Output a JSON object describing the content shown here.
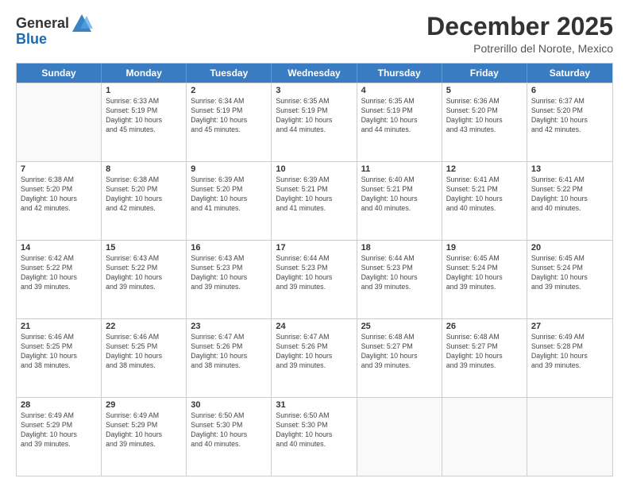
{
  "header": {
    "logo_general": "General",
    "logo_blue": "Blue",
    "month_title": "December 2025",
    "subtitle": "Potrerillo del Norote, Mexico"
  },
  "days_of_week": [
    "Sunday",
    "Monday",
    "Tuesday",
    "Wednesday",
    "Thursday",
    "Friday",
    "Saturday"
  ],
  "weeks": [
    [
      {
        "day": "",
        "empty": true
      },
      {
        "day": "1",
        "sunrise": "6:33 AM",
        "sunset": "5:19 PM",
        "daylight": "10 hours and 45 minutes."
      },
      {
        "day": "2",
        "sunrise": "6:34 AM",
        "sunset": "5:19 PM",
        "daylight": "10 hours and 45 minutes."
      },
      {
        "day": "3",
        "sunrise": "6:35 AM",
        "sunset": "5:19 PM",
        "daylight": "10 hours and 44 minutes."
      },
      {
        "day": "4",
        "sunrise": "6:35 AM",
        "sunset": "5:19 PM",
        "daylight": "10 hours and 44 minutes."
      },
      {
        "day": "5",
        "sunrise": "6:36 AM",
        "sunset": "5:20 PM",
        "daylight": "10 hours and 43 minutes."
      },
      {
        "day": "6",
        "sunrise": "6:37 AM",
        "sunset": "5:20 PM",
        "daylight": "10 hours and 42 minutes."
      }
    ],
    [
      {
        "day": "7",
        "sunrise": "6:38 AM",
        "sunset": "5:20 PM",
        "daylight": "10 hours and 42 minutes."
      },
      {
        "day": "8",
        "sunrise": "6:38 AM",
        "sunset": "5:20 PM",
        "daylight": "10 hours and 42 minutes."
      },
      {
        "day": "9",
        "sunrise": "6:39 AM",
        "sunset": "5:20 PM",
        "daylight": "10 hours and 41 minutes."
      },
      {
        "day": "10",
        "sunrise": "6:39 AM",
        "sunset": "5:21 PM",
        "daylight": "10 hours and 41 minutes."
      },
      {
        "day": "11",
        "sunrise": "6:40 AM",
        "sunset": "5:21 PM",
        "daylight": "10 hours and 40 minutes."
      },
      {
        "day": "12",
        "sunrise": "6:41 AM",
        "sunset": "5:21 PM",
        "daylight": "10 hours and 40 minutes."
      },
      {
        "day": "13",
        "sunrise": "6:41 AM",
        "sunset": "5:22 PM",
        "daylight": "10 hours and 40 minutes."
      }
    ],
    [
      {
        "day": "14",
        "sunrise": "6:42 AM",
        "sunset": "5:22 PM",
        "daylight": "10 hours and 39 minutes."
      },
      {
        "day": "15",
        "sunrise": "6:43 AM",
        "sunset": "5:22 PM",
        "daylight": "10 hours and 39 minutes."
      },
      {
        "day": "16",
        "sunrise": "6:43 AM",
        "sunset": "5:23 PM",
        "daylight": "10 hours and 39 minutes."
      },
      {
        "day": "17",
        "sunrise": "6:44 AM",
        "sunset": "5:23 PM",
        "daylight": "10 hours and 39 minutes."
      },
      {
        "day": "18",
        "sunrise": "6:44 AM",
        "sunset": "5:23 PM",
        "daylight": "10 hours and 39 minutes."
      },
      {
        "day": "19",
        "sunrise": "6:45 AM",
        "sunset": "5:24 PM",
        "daylight": "10 hours and 39 minutes."
      },
      {
        "day": "20",
        "sunrise": "6:45 AM",
        "sunset": "5:24 PM",
        "daylight": "10 hours and 39 minutes."
      }
    ],
    [
      {
        "day": "21",
        "sunrise": "6:46 AM",
        "sunset": "5:25 PM",
        "daylight": "10 hours and 38 minutes."
      },
      {
        "day": "22",
        "sunrise": "6:46 AM",
        "sunset": "5:25 PM",
        "daylight": "10 hours and 38 minutes."
      },
      {
        "day": "23",
        "sunrise": "6:47 AM",
        "sunset": "5:26 PM",
        "daylight": "10 hours and 38 minutes."
      },
      {
        "day": "24",
        "sunrise": "6:47 AM",
        "sunset": "5:26 PM",
        "daylight": "10 hours and 39 minutes."
      },
      {
        "day": "25",
        "sunrise": "6:48 AM",
        "sunset": "5:27 PM",
        "daylight": "10 hours and 39 minutes."
      },
      {
        "day": "26",
        "sunrise": "6:48 AM",
        "sunset": "5:27 PM",
        "daylight": "10 hours and 39 minutes."
      },
      {
        "day": "27",
        "sunrise": "6:49 AM",
        "sunset": "5:28 PM",
        "daylight": "10 hours and 39 minutes."
      }
    ],
    [
      {
        "day": "28",
        "sunrise": "6:49 AM",
        "sunset": "5:29 PM",
        "daylight": "10 hours and 39 minutes."
      },
      {
        "day": "29",
        "sunrise": "6:49 AM",
        "sunset": "5:29 PM",
        "daylight": "10 hours and 39 minutes."
      },
      {
        "day": "30",
        "sunrise": "6:50 AM",
        "sunset": "5:30 PM",
        "daylight": "10 hours and 40 minutes."
      },
      {
        "day": "31",
        "sunrise": "6:50 AM",
        "sunset": "5:30 PM",
        "daylight": "10 hours and 40 minutes."
      },
      {
        "day": "",
        "empty": true
      },
      {
        "day": "",
        "empty": true
      },
      {
        "day": "",
        "empty": true
      }
    ]
  ],
  "labels": {
    "sunrise_prefix": "Sunrise: ",
    "sunset_prefix": "Sunset: ",
    "daylight_prefix": "Daylight: "
  }
}
